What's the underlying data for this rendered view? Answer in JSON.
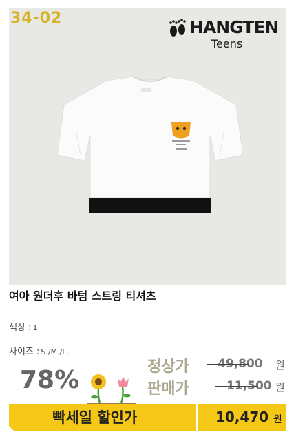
{
  "product_code": "34-02",
  "brand": {
    "name": "HANGTEN",
    "sub": "Teens",
    "icon": "footprints-icon"
  },
  "product": {
    "title": "여아 원더후 바텀 스트링 티셔츠",
    "color_label": "색상 :",
    "color_value": "1",
    "size_label": "사이즈 :",
    "size_value": "S./M./L.",
    "print_text": "WONDER WHO"
  },
  "pricing": {
    "discount": "78%",
    "regular_label": "정상가",
    "regular_price": "49,800",
    "sale_label": "판매가",
    "sale_price": "11,500",
    "currency": "원",
    "flash_label": "빡세일 할인가",
    "final_price": "10,470",
    "final_currency": "원"
  },
  "colors": {
    "accent": "#f5c817",
    "code": "#d7b32a",
    "shirt_band": "#111111"
  }
}
